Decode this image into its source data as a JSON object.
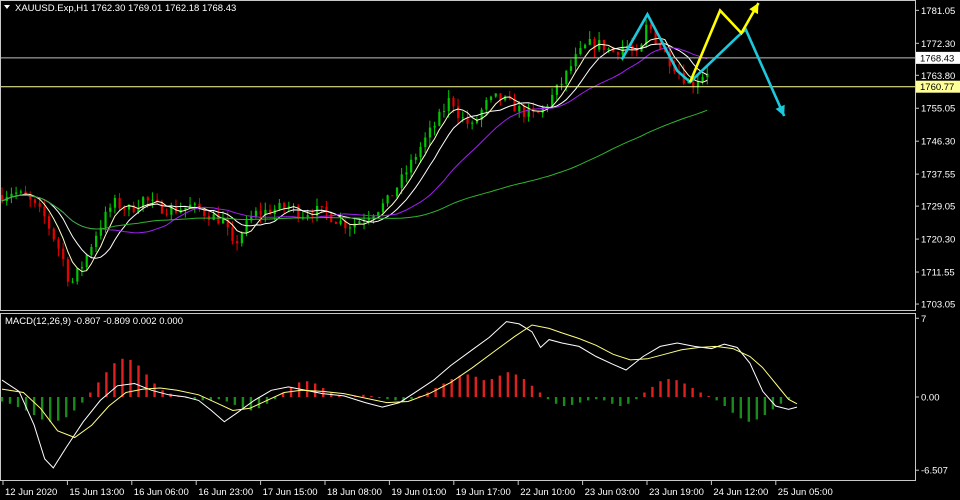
{
  "header": {
    "symbol_line": "XAUUSD.Exp,H1  1762.30 1769.01 1762.18 1768.43",
    "macd_line": "MACD(12,26,9) -0.807 -0.809 0.002 0.000"
  },
  "colors": {
    "background": "#000000",
    "border": "#c8c8c8",
    "bull_candle": "#00c800",
    "bear_candle": "#e60000",
    "ma_fast": "#ffffc8",
    "ma_mid": "#ffffff",
    "ma_slow_purple": "#a020f0",
    "ma_long_green": "#2fb52f",
    "forecast_yellow": "#ffff00",
    "forecast_cyan": "#1ec8dc",
    "level_line": "#ffff99",
    "price_line": "#c0c0c0",
    "macd_pos": "#e02020",
    "macd_neg": "#1a8a1a",
    "macd_main": "#ffffff",
    "macd_signal": "#ffff80"
  },
  "chart_data": [
    {
      "type": "candlestick",
      "title": "XAUUSD.Exp,H1",
      "x_labels": [
        "12 Jun 2020",
        "15 Jun 13:00",
        "16 Jun 06:00",
        "16 Jun 23:00",
        "17 Jun 15:00",
        "18 Jun 08:00",
        "19 Jun 01:00",
        "19 Jun 17:00",
        "22 Jun 10:00",
        "23 Jun 03:00",
        "23 Jun 19:00",
        "24 Jun 12:00",
        "25 Jun 05:00"
      ],
      "y_ticks": [
        "1781.05",
        "1772.30",
        "1763.80",
        "1755.05",
        "1746.30",
        "1737.55",
        "1729.05",
        "1720.30",
        "1711.55",
        "1703.05"
      ],
      "ylim": [
        1702,
        1783
      ],
      "current_price_label": "1768.43",
      "current_price": 1768.43,
      "horizontal_level_label": "1760.77",
      "horizontal_level": 1760.77,
      "close_path": [
        [
          0,
          1732
        ],
        [
          5,
          1733
        ],
        [
          12,
          1731
        ],
        [
          20,
          1726
        ],
        [
          28,
          1716
        ],
        [
          32,
          1708
        ],
        [
          38,
          1714
        ],
        [
          45,
          1723
        ],
        [
          52,
          1730
        ],
        [
          60,
          1728
        ],
        [
          66,
          1731
        ],
        [
          72,
          1729
        ],
        [
          80,
          1728
        ],
        [
          88,
          1729
        ],
        [
          96,
          1727
        ],
        [
          104,
          1725
        ],
        [
          108,
          1718
        ],
        [
          112,
          1722
        ],
        [
          118,
          1727
        ],
        [
          126,
          1728
        ],
        [
          134,
          1729
        ],
        [
          140,
          1727
        ],
        [
          146,
          1728
        ],
        [
          152,
          1727
        ],
        [
          158,
          1725
        ],
        [
          162,
          1724
        ],
        [
          166,
          1725
        ],
        [
          172,
          1727
        ],
        [
          180,
          1730
        ],
        [
          188,
          1737
        ],
        [
          196,
          1745
        ],
        [
          204,
          1752
        ],
        [
          210,
          1758
        ],
        [
          214,
          1753
        ],
        [
          220,
          1750
        ],
        [
          226,
          1756
        ],
        [
          232,
          1758
        ],
        [
          238,
          1756
        ],
        [
          244,
          1754
        ],
        [
          250,
          1753
        ],
        [
          256,
          1757
        ],
        [
          262,
          1762
        ],
        [
          268,
          1768
        ],
        [
          274,
          1772
        ],
        [
          280,
          1772
        ],
        [
          286,
          1770
        ],
        [
          292,
          1772
        ],
        [
          298,
          1768
        ],
        [
          302,
          1778
        ],
        [
          306,
          1773
        ],
        [
          312,
          1768
        ],
        [
          318,
          1764
        ],
        [
          322,
          1761
        ],
        [
          326,
          1763
        ],
        [
          330,
          1765
        ]
      ],
      "series": [
        {
          "name": "",
          "color_key": "ma_fast"
        },
        {
          "name": "",
          "color_key": "ma_mid"
        },
        {
          "name": "",
          "color_key": "ma_slow_purple"
        },
        {
          "name": "",
          "color_key": "ma_long_green"
        }
      ],
      "forecast_yellow": [
        [
          322,
          1762
        ],
        [
          336,
          1781
        ],
        [
          346,
          1775
        ],
        [
          354,
          1783
        ]
      ],
      "forecast_cyan_up": [
        [
          290,
          1768
        ],
        [
          302,
          1780
        ],
        [
          316,
          1765
        ],
        [
          322,
          1762
        ],
        [
          344,
          1774
        ],
        [
          348,
          1776
        ],
        [
          366,
          1753
        ]
      ]
    },
    {
      "type": "macd",
      "title": "MACD(12,26,9)",
      "y_ticks": [
        "7",
        "0.00",
        "-6.507"
      ],
      "ylim": [
        -7.2,
        7.2
      ],
      "histogram": [
        -0.4,
        -0.6,
        -0.9,
        -1.2,
        -1.6,
        -2.0,
        -2.2,
        -2.1,
        -1.8,
        -1.2,
        -0.5,
        0.4,
        1.3,
        2.2,
        3.0,
        3.4,
        3.3,
        2.8,
        2.0,
        1.2,
        0.6,
        0.3,
        0.1,
        -0.1,
        -0.2,
        -0.3,
        -0.3,
        -0.2,
        -0.4,
        -0.7,
        -1.0,
        -1.2,
        -1.0,
        -0.6,
        -0.2,
        0.4,
        0.9,
        1.3,
        1.4,
        1.2,
        0.8,
        0.4,
        0.1,
        0.0,
        0.1,
        0.2,
        0.1,
        -0.1,
        -0.2,
        -0.3,
        -0.4,
        -0.2,
        0.1,
        0.4,
        0.8,
        1.2,
        1.6,
        1.9,
        2.0,
        1.8,
        1.5,
        1.6,
        1.9,
        2.2,
        2.0,
        1.6,
        1.0,
        0.4,
        -0.2,
        -0.6,
        -0.8,
        -0.7,
        -0.5,
        -0.3,
        -0.2,
        -0.3,
        -0.6,
        -0.8,
        -0.6,
        -0.2,
        0.4,
        0.9,
        1.4,
        1.6,
        1.5,
        1.2,
        0.8,
        0.4,
        0.1,
        -0.3,
        -0.8,
        -1.4,
        -1.9,
        -2.2,
        -2.0,
        -1.6,
        -1.1,
        -0.6,
        -0.2,
        0.0
      ],
      "main": [
        [
          0,
          1.5
        ],
        [
          8,
          0.5
        ],
        [
          15,
          -2.5
        ],
        [
          20,
          -5.5
        ],
        [
          24,
          -6.3
        ],
        [
          30,
          -4.5
        ],
        [
          38,
          -2.2
        ],
        [
          46,
          -0.3
        ],
        [
          54,
          1.0
        ],
        [
          62,
          1.2
        ],
        [
          70,
          0.6
        ],
        [
          78,
          0.2
        ],
        [
          86,
          0.0
        ],
        [
          92,
          -0.3
        ],
        [
          98,
          -1.2
        ],
        [
          104,
          -2.2
        ],
        [
          110,
          -1.4
        ],
        [
          118,
          -0.3
        ],
        [
          126,
          0.6
        ],
        [
          134,
          0.9
        ],
        [
          142,
          0.6
        ],
        [
          150,
          0.3
        ],
        [
          160,
          0.1
        ],
        [
          170,
          -0.5
        ],
        [
          178,
          -0.9
        ],
        [
          186,
          -0.5
        ],
        [
          194,
          0.5
        ],
        [
          202,
          1.5
        ],
        [
          210,
          2.8
        ],
        [
          220,
          4.2
        ],
        [
          228,
          5.3
        ],
        [
          236,
          6.7
        ],
        [
          242,
          6.5
        ],
        [
          248,
          5.8
        ],
        [
          252,
          4.4
        ],
        [
          256,
          5.1
        ],
        [
          262,
          4.8
        ],
        [
          270,
          4.5
        ],
        [
          278,
          3.6
        ],
        [
          286,
          2.9
        ],
        [
          292,
          2.4
        ],
        [
          300,
          3.6
        ],
        [
          308,
          4.5
        ],
        [
          316,
          4.8
        ],
        [
          324,
          4.5
        ],
        [
          332,
          4.3
        ],
        [
          338,
          4.7
        ],
        [
          344,
          4.4
        ],
        [
          350,
          3.0
        ],
        [
          356,
          0.5
        ],
        [
          362,
          -0.8
        ],
        [
          368,
          -1.1
        ],
        [
          372,
          -0.9
        ]
      ],
      "signal": [
        [
          0,
          0.7
        ],
        [
          10,
          0.4
        ],
        [
          18,
          -1.0
        ],
        [
          26,
          -3.0
        ],
        [
          34,
          -3.6
        ],
        [
          42,
          -2.5
        ],
        [
          50,
          -0.8
        ],
        [
          58,
          0.4
        ],
        [
          66,
          0.7
        ],
        [
          74,
          0.8
        ],
        [
          82,
          0.6
        ],
        [
          92,
          0.2
        ],
        [
          100,
          -0.5
        ],
        [
          108,
          -1.2
        ],
        [
          116,
          -1.0
        ],
        [
          124,
          -0.3
        ],
        [
          132,
          0.4
        ],
        [
          140,
          0.6
        ],
        [
          150,
          0.5
        ],
        [
          160,
          0.3
        ],
        [
          170,
          -0.1
        ],
        [
          180,
          -0.5
        ],
        [
          190,
          -0.4
        ],
        [
          200,
          0.3
        ],
        [
          210,
          1.3
        ],
        [
          220,
          2.6
        ],
        [
          230,
          4.0
        ],
        [
          240,
          5.4
        ],
        [
          248,
          6.4
        ],
        [
          256,
          6.1
        ],
        [
          262,
          5.7
        ],
        [
          270,
          5.2
        ],
        [
          278,
          4.6
        ],
        [
          286,
          3.8
        ],
        [
          294,
          3.3
        ],
        [
          302,
          3.4
        ],
        [
          310,
          3.8
        ],
        [
          318,
          4.2
        ],
        [
          326,
          4.4
        ],
        [
          334,
          4.5
        ],
        [
          342,
          4.3
        ],
        [
          350,
          3.6
        ],
        [
          356,
          2.6
        ],
        [
          362,
          1.2
        ],
        [
          368,
          -0.2
        ],
        [
          372,
          -0.6
        ]
      ]
    }
  ]
}
